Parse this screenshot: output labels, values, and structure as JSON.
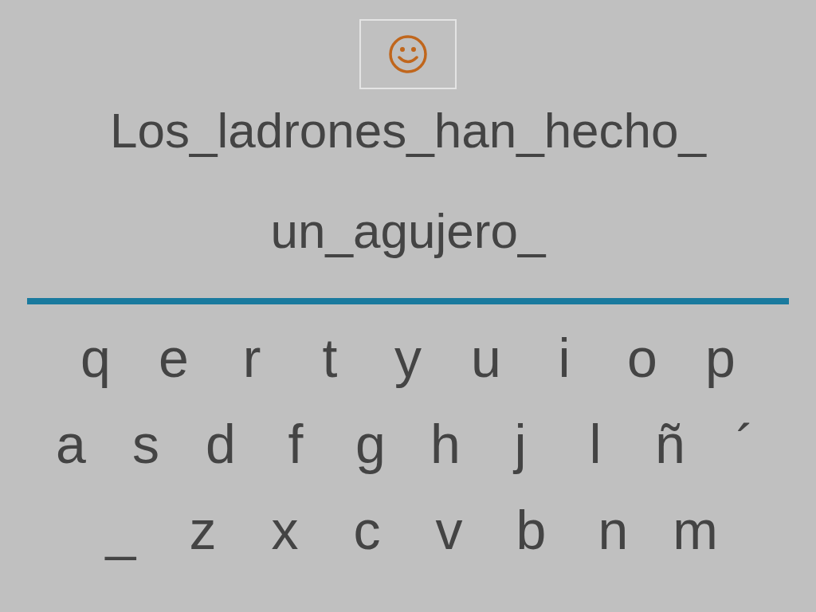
{
  "sentence_lines": [
    "Los_ladrones_han_hecho_",
    "un_agujero_"
  ],
  "keyboard_rows": [
    [
      "q",
      "e",
      "r",
      "t",
      "y",
      "u",
      "i",
      "o",
      "p"
    ],
    [
      "a",
      "s",
      "d",
      "f",
      "g",
      "h",
      "j",
      "l",
      "ñ",
      "´"
    ],
    [
      "_",
      "z",
      "x",
      "c",
      "v",
      "b",
      "n",
      "m"
    ]
  ]
}
